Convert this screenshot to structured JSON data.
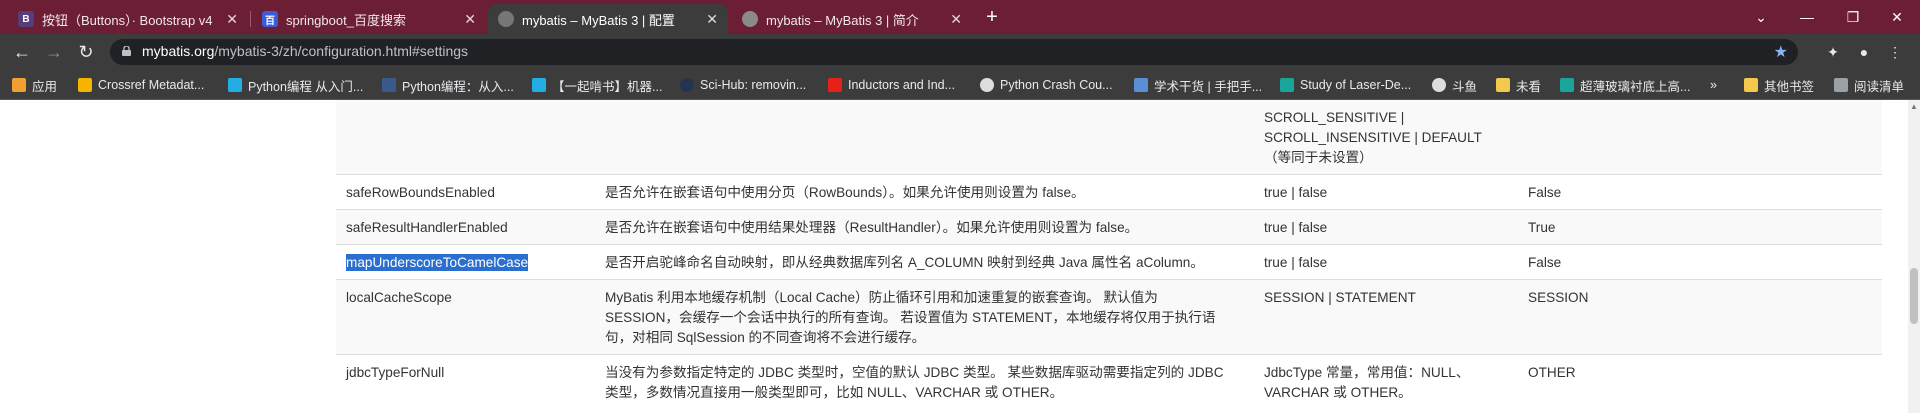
{
  "tabs": [
    {
      "title": "按钮（Buttons）· Bootstrap v4",
      "favicon": "bootstrap-icon",
      "active": false
    },
    {
      "title": "springboot_百度搜索",
      "favicon": "baidu-icon",
      "active": false
    },
    {
      "title": "mybatis – MyBatis 3 | 配置",
      "favicon": "globe-icon",
      "active": true
    },
    {
      "title": "mybatis – MyBatis 3 | 简介",
      "favicon": "globe-icon",
      "active": false
    }
  ],
  "address": {
    "host": "mybatis.org",
    "path": "/mybatis-3/zh/configuration.html#settings"
  },
  "bookmarks": [
    {
      "label": "应用",
      "icon": "apps-icon"
    },
    {
      "label": "Crossref Metadat...",
      "icon": "crossref-icon"
    },
    {
      "label": "Python编程 从入门...",
      "icon": "bilibili-icon"
    },
    {
      "label": "Python编程：从入...",
      "icon": "book-icon"
    },
    {
      "label": "【一起啃书】机器...",
      "icon": "bilibili-icon"
    },
    {
      "label": "Sci-Hub: removin...",
      "icon": "scihub-icon"
    },
    {
      "label": "Inductors and Ind...",
      "icon": "youtube-icon"
    },
    {
      "label": "Python Crash Cou...",
      "icon": "globe-icon"
    },
    {
      "label": "学术干货 | 手把手...",
      "icon": "image-icon"
    },
    {
      "label": "Study of Laser-De...",
      "icon": "page-icon"
    },
    {
      "label": "斗鱼",
      "icon": "globe-icon"
    },
    {
      "label": "未看",
      "icon": "folder-icon"
    },
    {
      "label": "超薄玻璃衬底上高...",
      "icon": "page-icon"
    },
    {
      "label": "»",
      "icon": ""
    },
    {
      "label": "其他书签",
      "icon": "folder-icon"
    },
    {
      "label": "阅读清单",
      "icon": "reading-list-icon"
    }
  ],
  "table": {
    "top_partial": {
      "c3_line1": "SCROLL_SENSITIVE |",
      "c3_line2": "SCROLL_INSENSITIVE | DEFAULT",
      "c3_line3": "（等同于未设置）"
    },
    "rows": [
      {
        "name": "safeRowBoundsEnabled",
        "desc": "是否允许在嵌套语句中使用分页（RowBounds）。如果允许使用则设置为 false。",
        "values": "true | false",
        "default": "False"
      },
      {
        "name": "safeResultHandlerEnabled",
        "desc": "是否允许在嵌套语句中使用结果处理器（ResultHandler）。如果允许使用则设置为 false。",
        "values": "true | false",
        "default": "True"
      },
      {
        "name": "mapUnderscoreToCamelCase",
        "desc": "是否开启驼峰命名自动映射，即从经典数据库列名 A_COLUMN 映射到经典 Java 属性名 aColumn。",
        "values": "true | false",
        "default": "False"
      },
      {
        "name": "localCacheScope",
        "desc1": "MyBatis 利用本地缓存机制（Local Cache）防止循环引用和加速重复的嵌套查询。 默认值为",
        "desc2": "SESSION，会缓存一个会话中执行的所有查询。 若设置值为 STATEMENT，本地缓存将仅用于执行语",
        "desc3": "句，对相同 SqlSession 的不同查询将不会进行缓存。",
        "values": "SESSION | STATEMENT",
        "default": "SESSION"
      },
      {
        "name": "jdbcTypeForNull",
        "desc1": "当没有为参数指定特定的 JDBC 类型时，空值的默认 JDBC 类型。 某些数据库驱动需要指定列的 JDBC",
        "desc2": "类型，多数情况直接用一般类型即可，比如 NULL、VARCHAR 或 OTHER。",
        "values1": "JdbcType 常量，常用值：NULL、",
        "values2": "VARCHAR 或 OTHER。",
        "default": "OTHER"
      }
    ]
  },
  "colors": {
    "tab_strip": "#6b1e34",
    "toolbar": "#3c3c3c",
    "highlight": "#2a6fcf"
  }
}
